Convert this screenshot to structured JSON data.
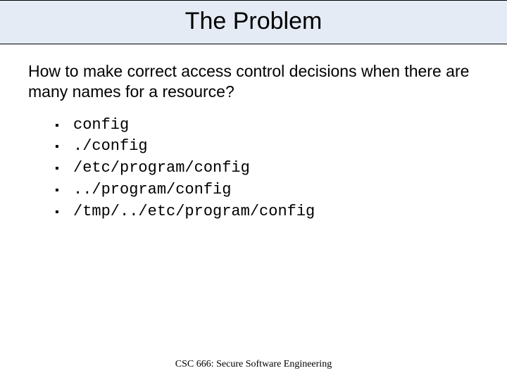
{
  "title": "The Problem",
  "question": "How to make correct access control decisions when there are many names for a resource?",
  "bullet_glyph": "▪",
  "paths": [
    "config",
    "./config",
    "/etc/program/config",
    "../program/config",
    "/tmp/../etc/program/config"
  ],
  "footer": "CSC 666: Secure Software Engineering"
}
